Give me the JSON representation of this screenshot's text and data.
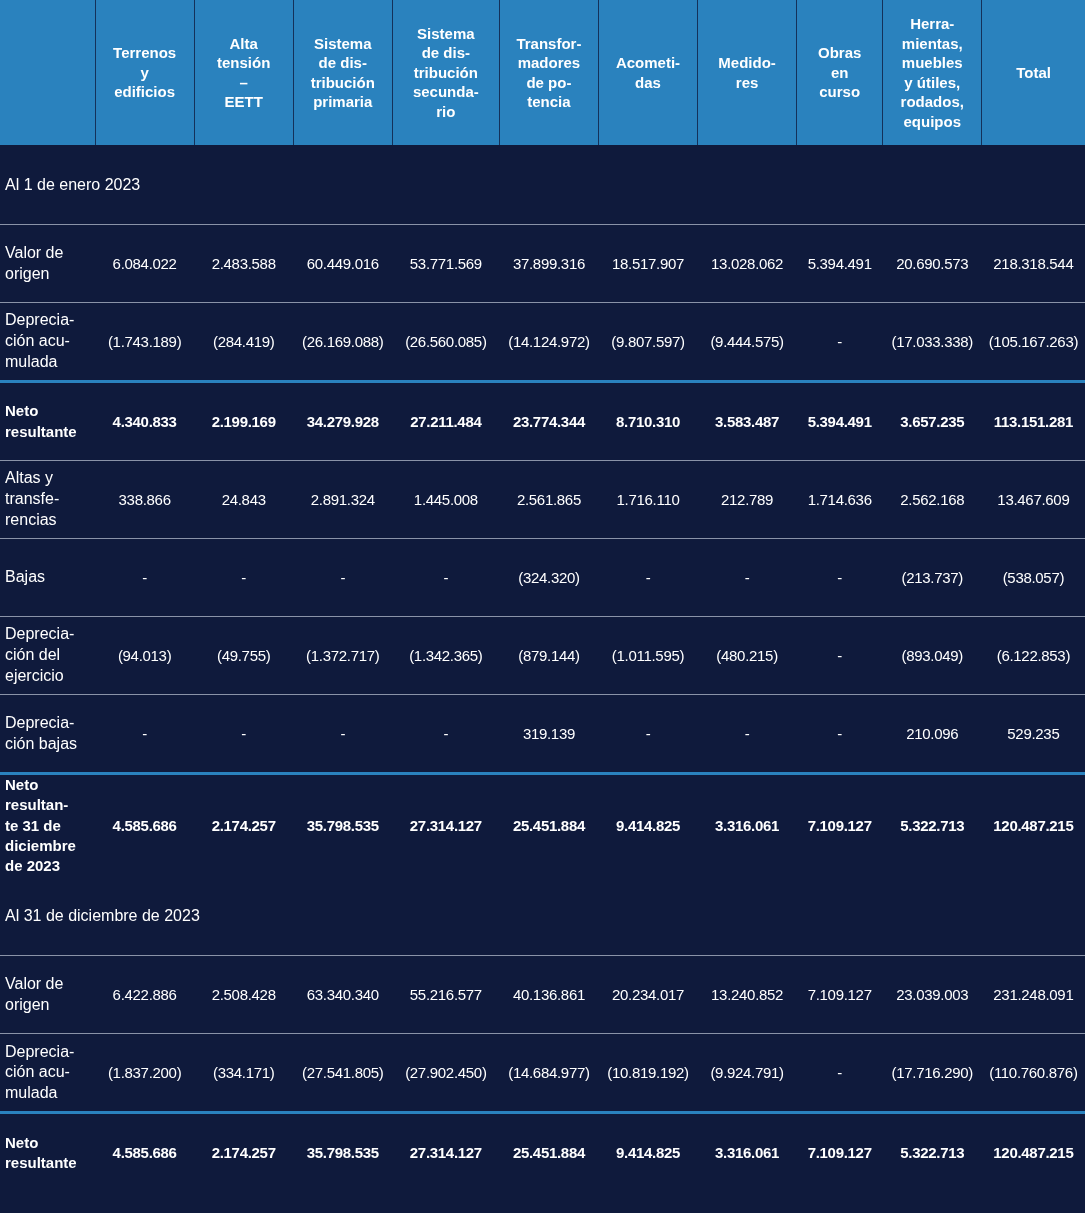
{
  "table": {
    "columns": [
      {
        "label": "Terrenos\ny\nedificios"
      },
      {
        "label": "Alta\ntensión\n–\nEETT"
      },
      {
        "label": "Sistema\nde dis-\ntribución\nprimaria"
      },
      {
        "label": "Sistema\nde dis-\ntribución\nsecunda-\nrio"
      },
      {
        "label": "Transfor-\nmadores\nde po-\ntencia"
      },
      {
        "label": "Acometi-\ndas"
      },
      {
        "label": "Medido-\nres"
      },
      {
        "label": "Obras\nen\ncurso"
      },
      {
        "label": "Herra-\nmientas,\nmuebles\ny útiles,\nrodados,\nequipos"
      },
      {
        "label": "Total"
      }
    ],
    "sections": [
      {
        "title": "Al 1 de enero 2023",
        "rows": [
          {
            "label": "Valor de\norigen",
            "kind": "normal",
            "values": [
              "6.084.022",
              "2.483.588",
              "60.449.016",
              "53.771.569",
              "37.899.316",
              "18.517.907",
              "13.028.062",
              "5.394.491",
              "20.690.573",
              "218.318.544"
            ]
          },
          {
            "label": "Deprecia-\nción acu-\nmulada",
            "kind": "normal",
            "values": [
              "(1.743.189)",
              "(284.419)",
              "(26.169.088)",
              "(26.560.085)",
              "(14.124.972)",
              "(9.807.597)",
              "(9.444.575)",
              "-",
              "(17.033.338)",
              "(105.167.263)"
            ]
          },
          {
            "label": "Neto\nresultante",
            "kind": "total",
            "values": [
              "4.340.833",
              "2.199.169",
              "34.279.928",
              "27.211.484",
              "23.774.344",
              "8.710.310",
              "3.583.487",
              "5.394.491",
              "3.657.235",
              "113.151.281"
            ]
          },
          {
            "label": "Altas y\ntransfe-\nrencias",
            "kind": "normal",
            "values": [
              "338.866",
              "24.843",
              "2.891.324",
              "1.445.008",
              "2.561.865",
              "1.716.110",
              "212.789",
              "1.714.636",
              "2.562.168",
              "13.467.609"
            ]
          },
          {
            "label": "Bajas",
            "kind": "normal",
            "values": [
              "-",
              "-",
              "-",
              "-",
              "(324.320)",
              "-",
              "-",
              "-",
              "(213.737)",
              "(538.057)"
            ]
          },
          {
            "label": "Deprecia-\nción del\nejercicio",
            "kind": "normal",
            "values": [
              "(94.013)",
              "(49.755)",
              "(1.372.717)",
              "(1.342.365)",
              "(879.144)",
              "(1.011.595)",
              "(480.215)",
              "-",
              "(893.049)",
              "(6.122.853)"
            ]
          },
          {
            "label": "Deprecia-\nción bajas",
            "kind": "normal",
            "values": [
              "-",
              "-",
              "-",
              "-",
              "319.139",
              "-",
              "-",
              "-",
              "210.096",
              "529.235"
            ]
          },
          {
            "label": "Neto\nresultan-\nte 31 de\ndiciembre\nde 2023",
            "kind": "total",
            "values": [
              "4.585.686",
              "2.174.257",
              "35.798.535",
              "27.314.127",
              "25.451.884",
              "9.414.825",
              "3.316.061",
              "7.109.127",
              "5.322.713",
              "120.487.215"
            ]
          }
        ]
      },
      {
        "title": "Al 31 de diciembre de 2023",
        "rows": [
          {
            "label": "Valor de\norigen",
            "kind": "normal",
            "values": [
              "6.422.886",
              "2.508.428",
              "63.340.340",
              "55.216.577",
              "40.136.861",
              "20.234.017",
              "13.240.852",
              "7.109.127",
              "23.039.003",
              "231.248.091"
            ]
          },
          {
            "label": "Deprecia-\nción acu-\nmulada",
            "kind": "normal",
            "values": [
              "(1.837.200)",
              "(334.171)",
              "(27.541.805)",
              "(27.902.450)",
              "(14.684.977)",
              "(10.819.192)",
              "(9.924.791)",
              "-",
              "(17.716.290)",
              "(110.760.876)"
            ]
          },
          {
            "label": "Neto\nresultante",
            "kind": "total",
            "values": [
              "4.585.686",
              "2.174.257",
              "35.798.535",
              "27.314.127",
              "25.451.884",
              "9.414.825",
              "3.316.061",
              "7.109.127",
              "5.322.713",
              "120.487.215"
            ]
          }
        ]
      }
    ]
  }
}
